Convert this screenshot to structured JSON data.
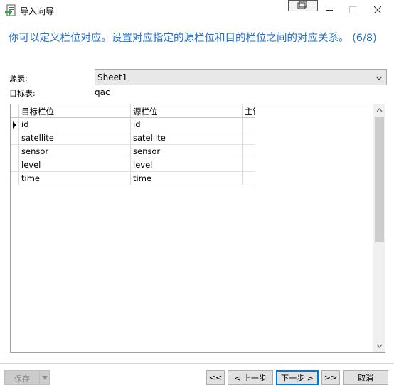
{
  "window": {
    "title": "导入向导",
    "icon": "import-wizard-icon"
  },
  "header": {
    "text": "你可以定义栏位对应。设置对应指定的源栏位和目的栏位之间的对应关系。 (6/8)"
  },
  "form": {
    "source_label": "源表:",
    "source_value": "Sheet1",
    "target_label": "目标表:",
    "target_value": "qac"
  },
  "grid": {
    "columns": [
      "目标栏位",
      "源栏位",
      "主键"
    ],
    "rows": [
      {
        "target": "id",
        "source": "id"
      },
      {
        "target": "satellite",
        "source": "satellite"
      },
      {
        "target": "sensor",
        "source": "sensor"
      },
      {
        "target": "level",
        "source": "level"
      },
      {
        "target": "time",
        "source": "time"
      }
    ]
  },
  "footer": {
    "save_label": "保存",
    "first_label": "<<",
    "prev_label": "< 上一步",
    "next_label": "下一步 >",
    "last_label": ">>",
    "cancel_label": "取消"
  },
  "colors": {
    "header_text": "#1e6fd0",
    "focus_border": "#0078d7"
  }
}
